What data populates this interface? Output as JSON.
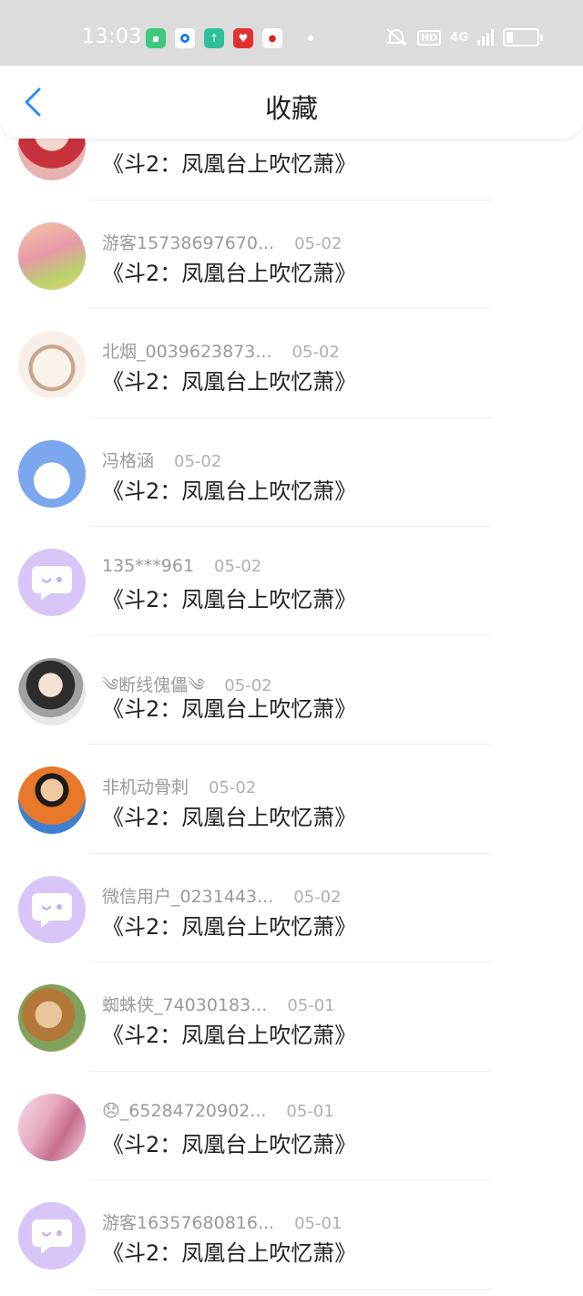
{
  "status_bar": {
    "time": "13:03",
    "network": "4G"
  },
  "header": {
    "title": "收藏"
  },
  "colors": {
    "accent": "#2d8cf0",
    "purple_avatar": "#d7c6f7"
  },
  "items": [
    {
      "user": "",
      "date": "",
      "title": "《斗2：凤凰台上吹忆萧》"
    },
    {
      "user": "游客15738697670...",
      "date": "05-02",
      "title": "《斗2：凤凰台上吹忆萧》"
    },
    {
      "user": "北烟_0039623873...",
      "date": "05-02",
      "title": "《斗2：凤凰台上吹忆萧》"
    },
    {
      "user": "冯格涵",
      "date": "05-02",
      "title": "《斗2：凤凰台上吹忆萧》"
    },
    {
      "user": "135***961",
      "date": "05-02",
      "title": "《斗2：凤凰台上吹忆萧》"
    },
    {
      "user": "༄断线傀儡༄",
      "date": "05-02",
      "title": "《斗2：凤凰台上吹忆萧》"
    },
    {
      "user": "非机动骨刺",
      "date": "05-02",
      "title": "《斗2：凤凰台上吹忆萧》"
    },
    {
      "user": "微信用户_0231443...",
      "date": "05-02",
      "title": "《斗2：凤凰台上吹忆萧》"
    },
    {
      "user": "蜘蛛侠_74030183...",
      "date": "05-01",
      "title": "《斗2：凤凰台上吹忆萧》"
    },
    {
      "user": "😞_65284720902...",
      "date": "05-01",
      "title": "《斗2：凤凰台上吹忆萧》"
    },
    {
      "user": "游客16357680816...",
      "date": "05-01",
      "title": "《斗2：凤凰台上吹忆萧》"
    }
  ]
}
